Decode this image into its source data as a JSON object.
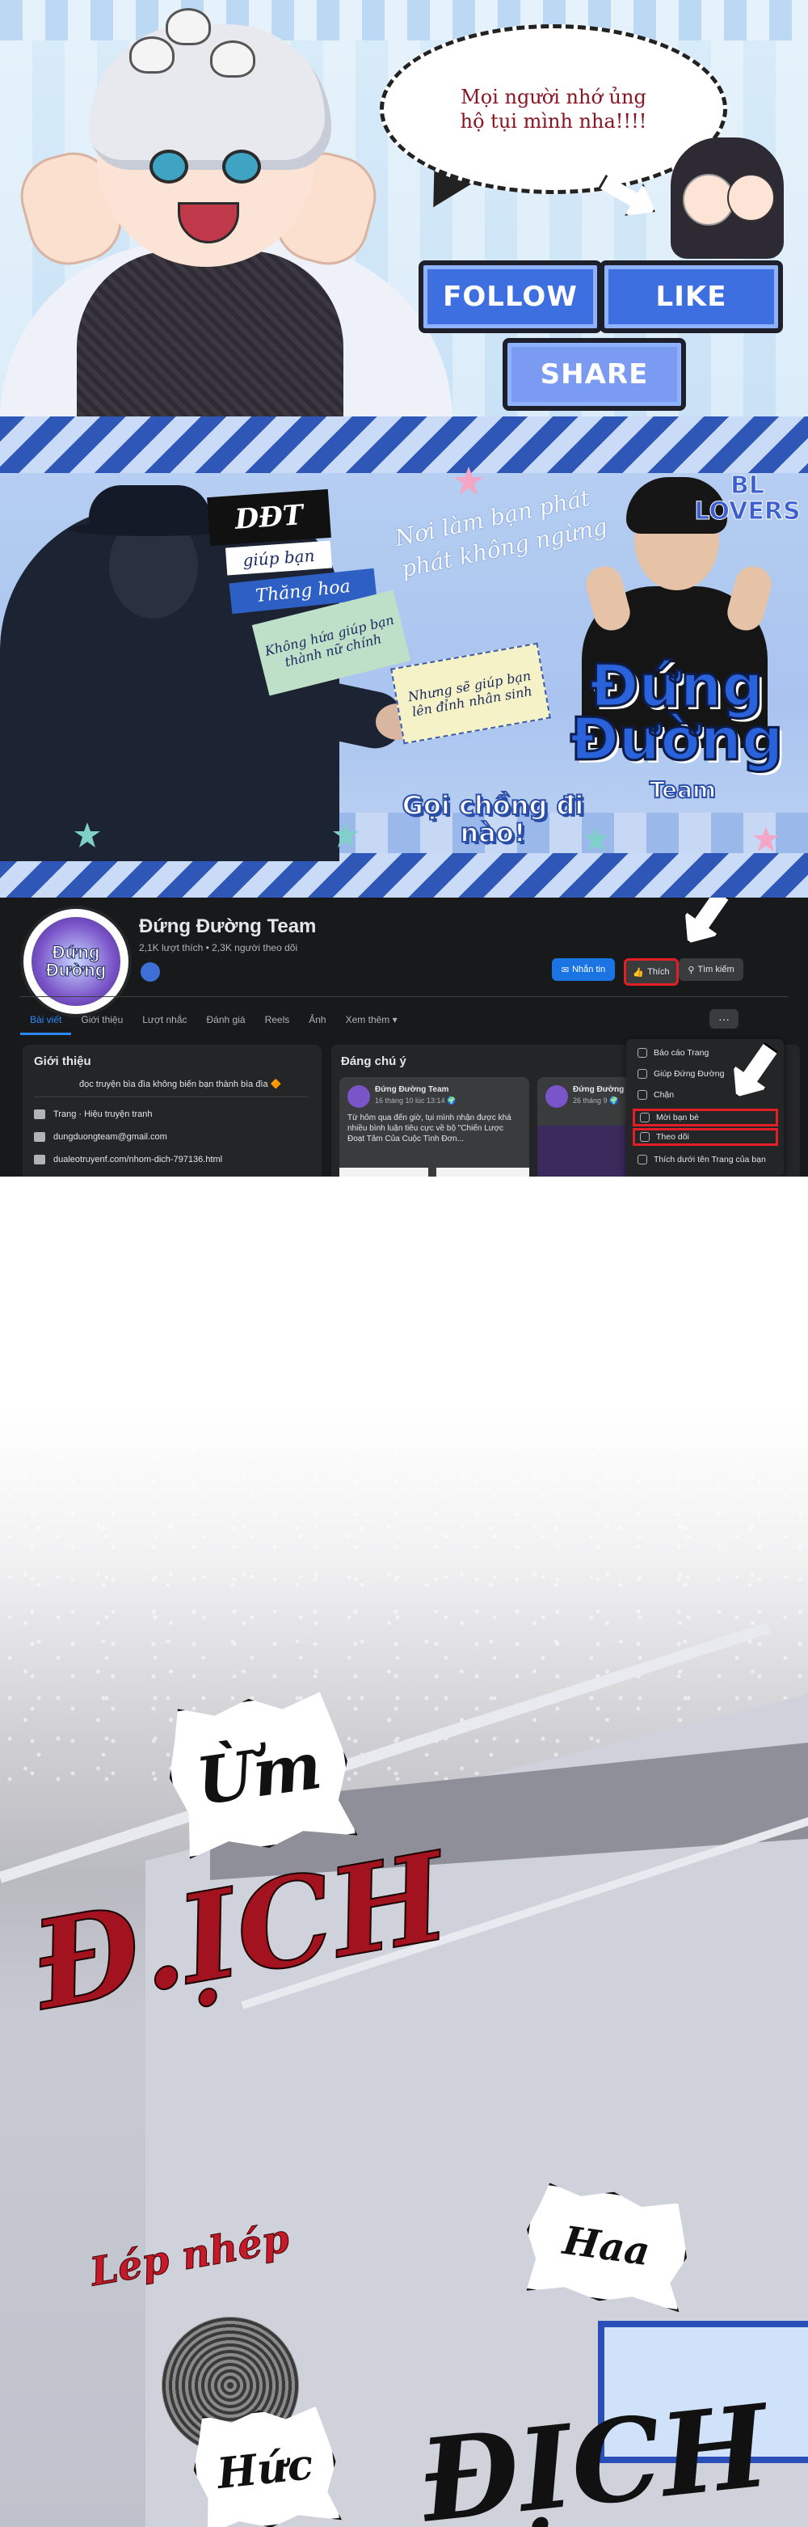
{
  "banner_promo": {
    "speech_text": "Mọi người nhớ ủng hộ tụi mình nha!!!!",
    "follow_label": "FOLLOW",
    "like_label": "LIKE",
    "share_label": "SHARE"
  },
  "banner_team": {
    "ddt_label": "DĐT",
    "tag_help": "giúp bạn",
    "tag_rise": "Thăng hoa",
    "note_green": "Không hứa giúp bạn thành nữ chính",
    "note_yellow": "Nhưng sẽ giúp bạn lên đỉnh nhân sinh",
    "script_text": "Nơi làm bạn phát phát không ngừng",
    "bl_lovers": "BL LOVERS",
    "team_title": "Đứng Đường",
    "team_sub": "Team",
    "call_out": "Gọi chồng đi nào!"
  },
  "facebook": {
    "avatar_text": "Đứng Đường",
    "page_name": "Đứng Đường Team",
    "stats": "2,1K lượt thích • 2,3K người theo dõi",
    "buttons": {
      "message": "Nhắn tin",
      "like": "Thích",
      "search": "Tìm kiếm"
    },
    "tabs": [
      "Bài viết",
      "Giới thiệu",
      "Lượt nhắc",
      "Đánh giá",
      "Reels",
      "Ảnh",
      "Xem thêm ▾"
    ],
    "more_button": "···",
    "intro": {
      "title": "Giới thiệu",
      "bio": "đọc truyện bìa đìa không biến bạn thành bìa đìa 🔶",
      "rows": [
        "Trang · Hiệu truyện tranh",
        "dungduongteam@gmail.com",
        "dualeotruyenf.com/nhom-dich-797136.html"
      ]
    },
    "pinned": {
      "title": "Đáng chú ý",
      "posts": [
        {
          "author": "Đứng Đường Team",
          "date": "16 tháng 10 lúc 13:14 🌍",
          "text": "Từ hôm qua đến giờ, tụi mình nhận được khá nhiều bình luận tiêu cực về bộ \"Chiến Lược Đoạt Tâm Của Cuộc Tình Đơn..."
        },
        {
          "author": "Đứng Đường Team",
          "date": "26 tháng 9 🌍",
          "text": ""
        }
      ]
    },
    "menu_items": [
      "Báo cáo Trang",
      "Giúp Đứng Đường",
      "Chặn",
      "Mời bạn bè",
      "Theo dõi",
      "Thích dưới tên Trang của bạn"
    ]
  },
  "comic": {
    "sfx_um": "Ừm",
    "sfx_dich": "Đ.ỊCH",
    "sfx_lep_nhep": "Lép nhép",
    "sfx_hah": "Haa",
    "sfx_huc": "Hức",
    "sfx_dich2": "ĐỊCH"
  },
  "colors": {
    "accent_blue": "#3d6fe0",
    "facebook_dark": "#18191a",
    "highlight_red": "#e41e26",
    "sfx_red": "#a3121f"
  }
}
